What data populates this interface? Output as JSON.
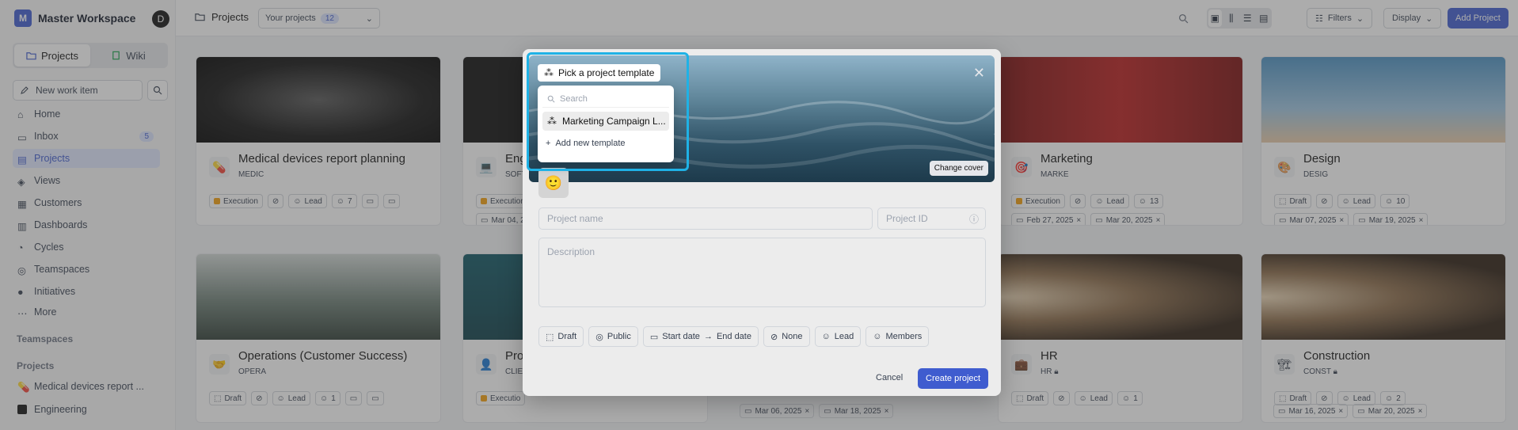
{
  "workspace": {
    "initial": "M",
    "name": "Master Workspace",
    "user_initial": "D"
  },
  "sidebar": {
    "tabs": [
      "Projects",
      "Wiki"
    ],
    "new_item": "New work item",
    "nav": [
      {
        "label": "Home"
      },
      {
        "label": "Inbox",
        "count": "5"
      },
      {
        "label": "Projects"
      },
      {
        "label": "Views"
      },
      {
        "label": "Customers"
      },
      {
        "label": "Dashboards"
      },
      {
        "label": "Cycles"
      },
      {
        "label": "Teamspaces"
      },
      {
        "label": "Initiatives"
      },
      {
        "label": "More"
      }
    ],
    "section_teamspaces": "Teamspaces",
    "section_projects": "Projects",
    "projects": [
      "Medical devices report ...",
      "Engineering"
    ]
  },
  "topbar": {
    "title": "Projects",
    "filter_label": "Your projects",
    "filter_count": "12",
    "filters": "Filters",
    "display": "Display",
    "add": "Add Project"
  },
  "cards": [
    {
      "name": "Medical devices report planning",
      "id": "MEDIC",
      "state": "Execution",
      "lead": "Lead",
      "members": "7",
      "emoji": "💊"
    },
    {
      "name": "Eng",
      "id": "SOFT",
      "state": "Execution",
      "start": "Mar 04, 2",
      "emoji": "💻"
    },
    {
      "name": "Marketing",
      "id": "MARKE",
      "state": "Execution",
      "lead": "Lead",
      "members": "13",
      "start": "Feb 27, 2025",
      "end": "Mar 20, 2025",
      "emoji": "🎯"
    },
    {
      "name": "Design",
      "id": "DESIG",
      "state": "Draft",
      "lead": "Lead",
      "members": "10",
      "start": "Mar 07, 2025",
      "end": "Mar 19, 2025",
      "emoji": "🎨"
    },
    {
      "name": "Operations (Customer Success)",
      "id": "OPERA",
      "state": "Draft",
      "lead": "Lead",
      "members": "1",
      "emoji": "🤝"
    },
    {
      "name": "Pro",
      "id": "CLIE",
      "state": "Executio",
      "emoji": "👤"
    },
    {
      "name": "HR",
      "id": "HR",
      "state": "Draft",
      "lead": "Lead",
      "members": "1",
      "start": "Mar 06, 2025",
      "end": "Mar 18, 2025",
      "emoji": "💼"
    },
    {
      "name": "Construction",
      "id": "CONST",
      "state": "Draft",
      "lead": "Lead",
      "members": "2",
      "start": "Mar 16, 2025",
      "end": "Mar 20, 2025",
      "emoji": "🏗"
    }
  ],
  "modal": {
    "template_label": "Pick a project template",
    "search_placeholder": "Search",
    "template_item": "Marketing Campaign L...",
    "add_template": "Add new template",
    "change_cover": "Change cover",
    "emoji": "🙂",
    "name_placeholder": "Project name",
    "id_placeholder": "Project ID",
    "desc_placeholder": "Description",
    "props": {
      "state": "Draft",
      "network": "Public",
      "start": "Start date",
      "end": "End date",
      "priority": "None",
      "lead": "Lead",
      "members": "Members"
    },
    "cancel": "Cancel",
    "create": "Create project"
  }
}
